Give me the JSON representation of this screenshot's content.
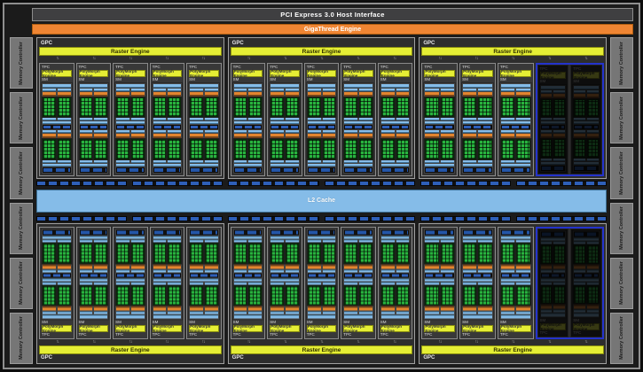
{
  "header": {
    "pcie_label": "PCI Express 3.0 Host Interface",
    "gigathread_label": "GigaThread Engine"
  },
  "memory": {
    "controller_label": "Memory Controller",
    "left_count": 6,
    "right_count": 6
  },
  "l2": {
    "label": "L2 Cache",
    "port_groups": 6
  },
  "gpc": {
    "label": "GPC",
    "raster_label": "Raster Engine",
    "tpc_label": "TPC",
    "polymorph_label": "PolyMorph Engine",
    "sm_label": "SM",
    "flow_icon": "↑↓",
    "tpcs_per_gpc": 5
  },
  "gpc_rows": {
    "top": [
      {
        "disabled": []
      },
      {
        "disabled": []
      },
      {
        "disabled": [
          3,
          4
        ]
      }
    ],
    "bottom": [
      {
        "disabled": []
      },
      {
        "disabled": []
      },
      {
        "disabled": [
          3,
          4
        ]
      }
    ]
  },
  "colors": {
    "accent_orange": "#ef8533",
    "accent_yellow": "#e5ee35",
    "light_blue": "#85bce8",
    "segment_blue": "#2e5fb8",
    "core_green": "#28b33e",
    "disabled_outline": "#2433cc",
    "frame_gray": "#8f8f8f"
  }
}
